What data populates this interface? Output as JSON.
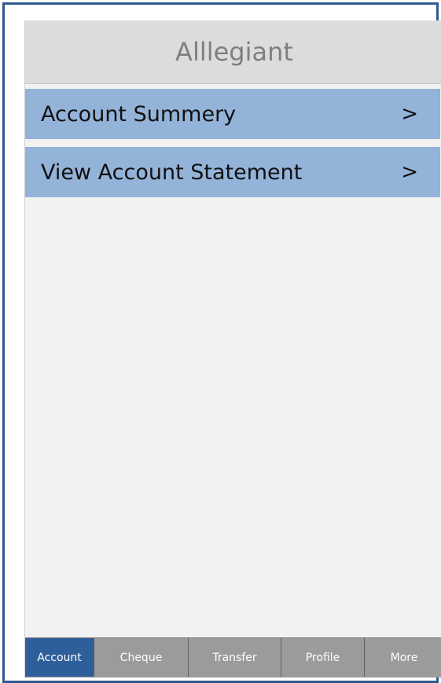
{
  "header": {
    "title": "Alllegiant"
  },
  "menu": {
    "items": [
      {
        "label": "Account Summery",
        "chevron": ">"
      },
      {
        "label": "View Account Statement",
        "chevron": ">"
      }
    ]
  },
  "tabs": [
    {
      "label": "Account",
      "active": true
    },
    {
      "label": "Cheque",
      "active": false
    },
    {
      "label": "Transfer",
      "active": false
    },
    {
      "label": "Profile",
      "active": false
    },
    {
      "label": "More",
      "active": false
    }
  ],
  "colors": {
    "frame_border": "#2e5a8e",
    "header_bg": "#dcdcdc",
    "title_text": "#7f7f7f",
    "menu_row_bg": "#94b3d9",
    "tab_bg": "#9b9b9b",
    "tab_active_bg": "#2f5f9a"
  }
}
